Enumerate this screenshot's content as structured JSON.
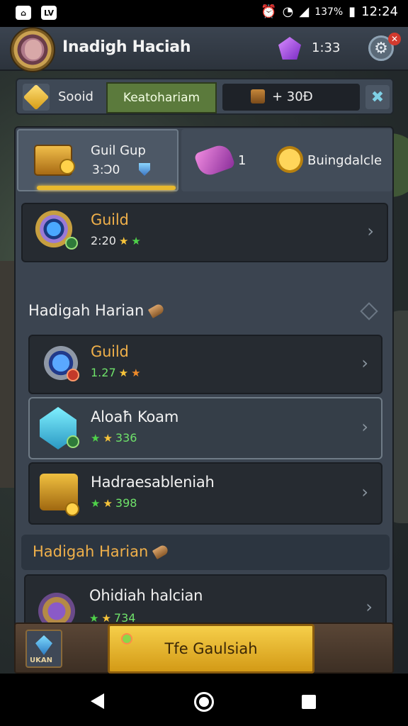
{
  "status_bar": {
    "app_icon_1": "home-app-icon",
    "app_icon_2": "LV",
    "battery": "137%",
    "time": "12:24"
  },
  "header": {
    "player_name": "Inadigh Haciah",
    "gems": "1:33"
  },
  "resources": {
    "label": "Sooid",
    "tab": "Keatohariam",
    "coins": "+ 30Đ"
  },
  "tabs": {
    "guild": {
      "title": "Guil Gup",
      "sub": "3:Ɔ0"
    },
    "other": {
      "count": "1",
      "label": "Buingdalcle"
    }
  },
  "list": {
    "top_card": {
      "title": "Guild",
      "sub": "2:20"
    },
    "section_1": {
      "title": "Hadigah Harian"
    },
    "items": [
      {
        "title": "Guild",
        "sub": "1.27"
      },
      {
        "title": "Aloaħ Koam",
        "sub": "336"
      },
      {
        "title": "Hadraesableniah",
        "sub": "398"
      }
    ],
    "section_2": {
      "title": "Hadigah Harian"
    },
    "last_card": {
      "title": "Ohidiah halcian",
      "sub": "734"
    }
  },
  "bottom": {
    "gem_label": "UKAN",
    "cta": "Tfe Gaulsiah"
  },
  "colors": {
    "accent_gold": "#f0b04a",
    "green": "#6fe26a",
    "panel": "#3b4450"
  }
}
